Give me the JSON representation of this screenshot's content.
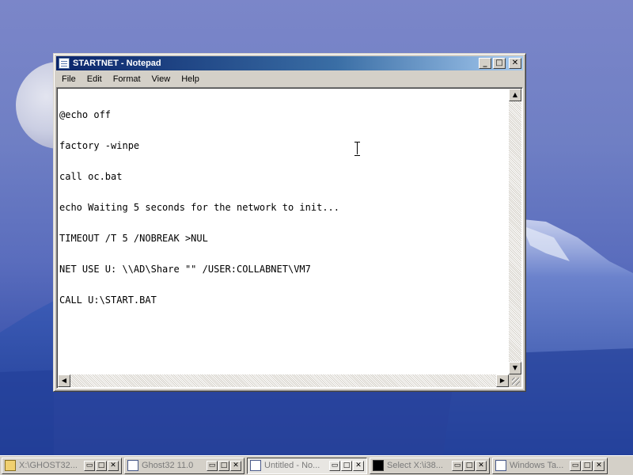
{
  "notepad": {
    "title": "STARTNET - Notepad",
    "title_buttons": {
      "minimize": "_",
      "maximize": "□",
      "close": "✕"
    },
    "menu": [
      "File",
      "Edit",
      "Format",
      "View",
      "Help"
    ],
    "lines": [
      "@echo off",
      "factory -winpe",
      "call oc.bat",
      "echo Waiting 5 seconds for the network to init...",
      "TIMEOUT /T 5 /NOBREAK >NUL",
      "NET USE U: \\\\AD\\Share \"\" /USER:COLLABNET\\VM7",
      "CALL U:\\START.BAT"
    ],
    "scroll": {
      "up": "▲",
      "down": "▼",
      "left": "◀",
      "right": "▶"
    }
  },
  "taskbar": {
    "items": [
      {
        "label": "X:\\GHOST32...",
        "icon": "folder-icon"
      },
      {
        "label": "Ghost32 11.0",
        "icon": "window-icon"
      },
      {
        "label": "Untitled - No...",
        "icon": "notepad-icon"
      },
      {
        "label": "Select X:\\i38...",
        "icon": "cmd-icon"
      },
      {
        "label": "Windows Ta...",
        "icon": "monitor-icon"
      }
    ],
    "buttons": {
      "restore": "▭",
      "maximize": "□",
      "close": "✕"
    }
  }
}
